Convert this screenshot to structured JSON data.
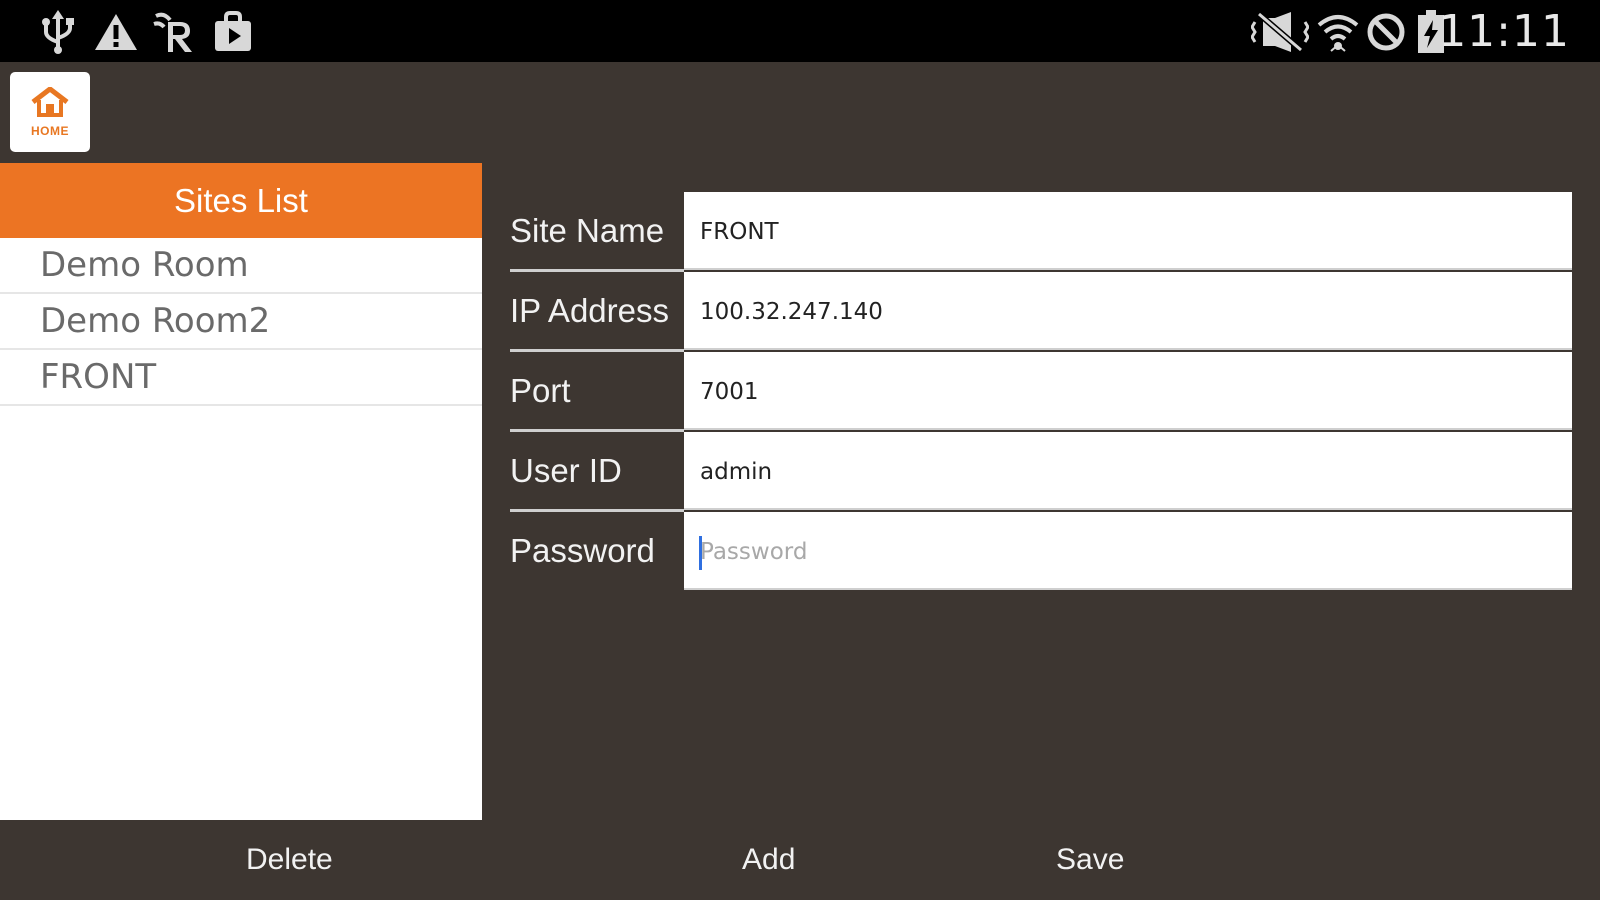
{
  "status_bar": {
    "time": "11:11",
    "left_icons": [
      "usb-icon",
      "warning-icon",
      "network-icon",
      "store-icon"
    ],
    "right_icons": [
      "vibrate-mute-icon",
      "wifi-icon",
      "block-icon",
      "battery-charging-icon"
    ]
  },
  "home": {
    "label": "HOME",
    "icon": "home-icon"
  },
  "sites": {
    "header": "Sites List",
    "items": [
      "Demo Room",
      "Demo Room2",
      "FRONT"
    ]
  },
  "form": {
    "site_name": {
      "label": "Site Name",
      "value": "FRONT"
    },
    "ip_address": {
      "label": "IP Address",
      "value": "100.32.247.140"
    },
    "port": {
      "label": "Port",
      "value": "7001"
    },
    "user_id": {
      "label": "User ID",
      "value": "admin"
    },
    "password": {
      "label": "Password",
      "value": "",
      "placeholder": "Password"
    }
  },
  "actions": {
    "delete": "Delete",
    "add": "Add",
    "save": "Save"
  },
  "colors": {
    "accent": "#ec7423",
    "background": "#3d3631",
    "status_bar": "#000000",
    "panel": "#ffffff"
  }
}
